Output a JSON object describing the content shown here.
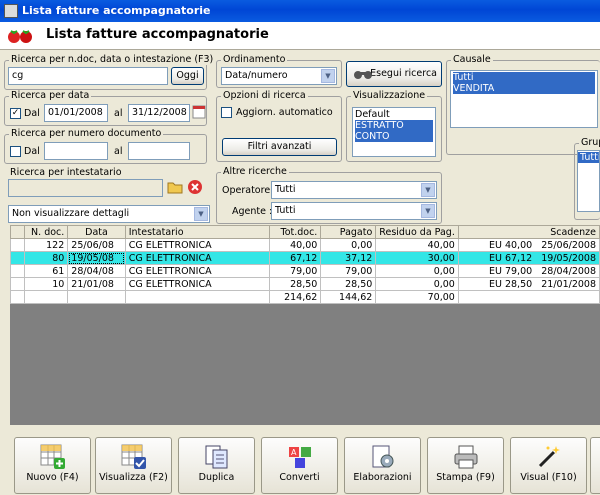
{
  "window": {
    "title": "Lista fatture accompagnatorie"
  },
  "header": {
    "title": "Lista fatture accompagnatorie"
  },
  "search": {
    "label": "Ricerca per n.doc, data o intestazione (F3)",
    "value": "cg",
    "today_button": "Oggi"
  },
  "date_search": {
    "label": "Ricerca per data",
    "dal_checked": true,
    "dal_label": "Dal",
    "dal_value": "01/01/2008",
    "al_label": "al",
    "al_value": "31/12/2008"
  },
  "number_search": {
    "label": "Ricerca per numero documento",
    "dal_checked": false,
    "dal_label": "Dal",
    "dal_value": "",
    "al_label": "al",
    "al_value": ""
  },
  "owner_search": {
    "label": "Ricerca per intestatario",
    "value": ""
  },
  "details_select": {
    "value": "Non visualizzare dettagli"
  },
  "ordering": {
    "label": "Ordinamento",
    "value": "Data/numero"
  },
  "run_search_button": "Esegui ricerca",
  "search_options": {
    "label": "Opzioni di ricerca",
    "auto_update": "Aggiorn. automatico",
    "auto_update_checked": false,
    "advanced_filters": "Filtri avanzati"
  },
  "display": {
    "label": "Visualizzazione",
    "items": [
      "Default",
      "ESTRATTO CONTO"
    ],
    "selected_index": 1
  },
  "causale": {
    "label": "Causale",
    "items": [
      "Tutti",
      "VENDITA"
    ],
    "selected_all": true
  },
  "group": {
    "label": "Grup",
    "items": [
      "Tutti"
    ]
  },
  "other_searches": {
    "label": "Altre ricerche",
    "operator_label": "Operatore :",
    "operator_value": "Tutti",
    "agent_label": "Agente :",
    "agent_value": "Tutti"
  },
  "table": {
    "columns": [
      "N. doc.",
      "Data",
      "Intestatario",
      "Tot.doc.",
      "Pagato",
      "Residuo da Pag.",
      "Scadenze"
    ],
    "rows": [
      {
        "num": "122",
        "date": "25/06/08",
        "owner": "CG ELETTRONICA",
        "total": "40,00",
        "paid": "0,00",
        "residual": "40,00",
        "due_amount": "EU 40,00",
        "due_date": "25/06/2008",
        "highlight": false
      },
      {
        "num": "80",
        "date": "19/05/08",
        "owner": "CG ELETTRONICA",
        "total": "67,12",
        "paid": "37,12",
        "residual": "30,00",
        "due_amount": "EU 67,12",
        "due_date": "19/05/2008",
        "highlight": true
      },
      {
        "num": "61",
        "date": "28/04/08",
        "owner": "CG ELETTRONICA",
        "total": "79,00",
        "paid": "79,00",
        "residual": "0,00",
        "due_amount": "EU 79,00",
        "due_date": "28/04/2008",
        "highlight": false
      },
      {
        "num": "10",
        "date": "21/01/08",
        "owner": "CG ELETTRONICA",
        "total": "28,50",
        "paid": "28,50",
        "residual": "0,00",
        "due_amount": "EU 28,50",
        "due_date": "21/01/2008",
        "highlight": false
      }
    ],
    "totals": {
      "total": "214,62",
      "paid": "144,62",
      "residual": "70,00"
    }
  },
  "toolbar": [
    {
      "label": "Nuovo (F4)",
      "icon": "new-grid-icon"
    },
    {
      "label": "Visualizza (F2)",
      "icon": "view-grid-icon"
    },
    {
      "label": "Duplica",
      "icon": "duplicate-icon"
    },
    {
      "label": "Converti",
      "icon": "convert-icon"
    },
    {
      "label": "Elaborazioni",
      "icon": "process-icon"
    },
    {
      "label": "Stampa (F9)",
      "icon": "printer-icon"
    },
    {
      "label": "Visual (F10)",
      "icon": "magic-wand-icon"
    }
  ]
}
